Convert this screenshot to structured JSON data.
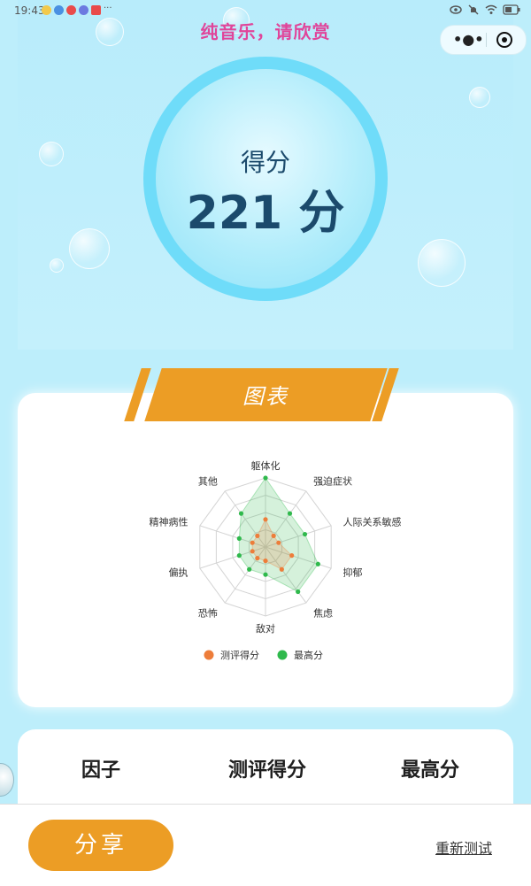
{
  "status_bar": {
    "time": "19:43",
    "more": "···"
  },
  "header": {
    "banner": "纯音乐，请欣赏",
    "menu_label": "•●•"
  },
  "score": {
    "label": "得分",
    "value": "221 分"
  },
  "chart_section": {
    "title": "图表"
  },
  "chart_data": {
    "type": "radar",
    "axes": [
      "躯体化",
      "强迫症状",
      "人际关系敏感",
      "抑郁",
      "焦虑",
      "敌对",
      "恐怖",
      "偏执",
      "精神病性",
      "其他"
    ],
    "series": [
      {
        "name": "测评得分",
        "color": "#ed7d3a",
        "values": [
          2,
          1,
          1,
          2,
          2,
          1,
          1,
          1,
          1,
          1
        ]
      },
      {
        "name": "最高分",
        "color": "#2fb94c",
        "values": [
          5,
          3,
          3,
          4,
          4,
          2,
          2,
          2,
          2,
          3
        ]
      }
    ],
    "max": 5,
    "rings": 4,
    "legend_position": "bottom"
  },
  "table": {
    "headers": [
      "因子",
      "测评得分",
      "最高分"
    ]
  },
  "bottom_bar": {
    "share_label": "分享",
    "retest_label": "重新测试"
  }
}
